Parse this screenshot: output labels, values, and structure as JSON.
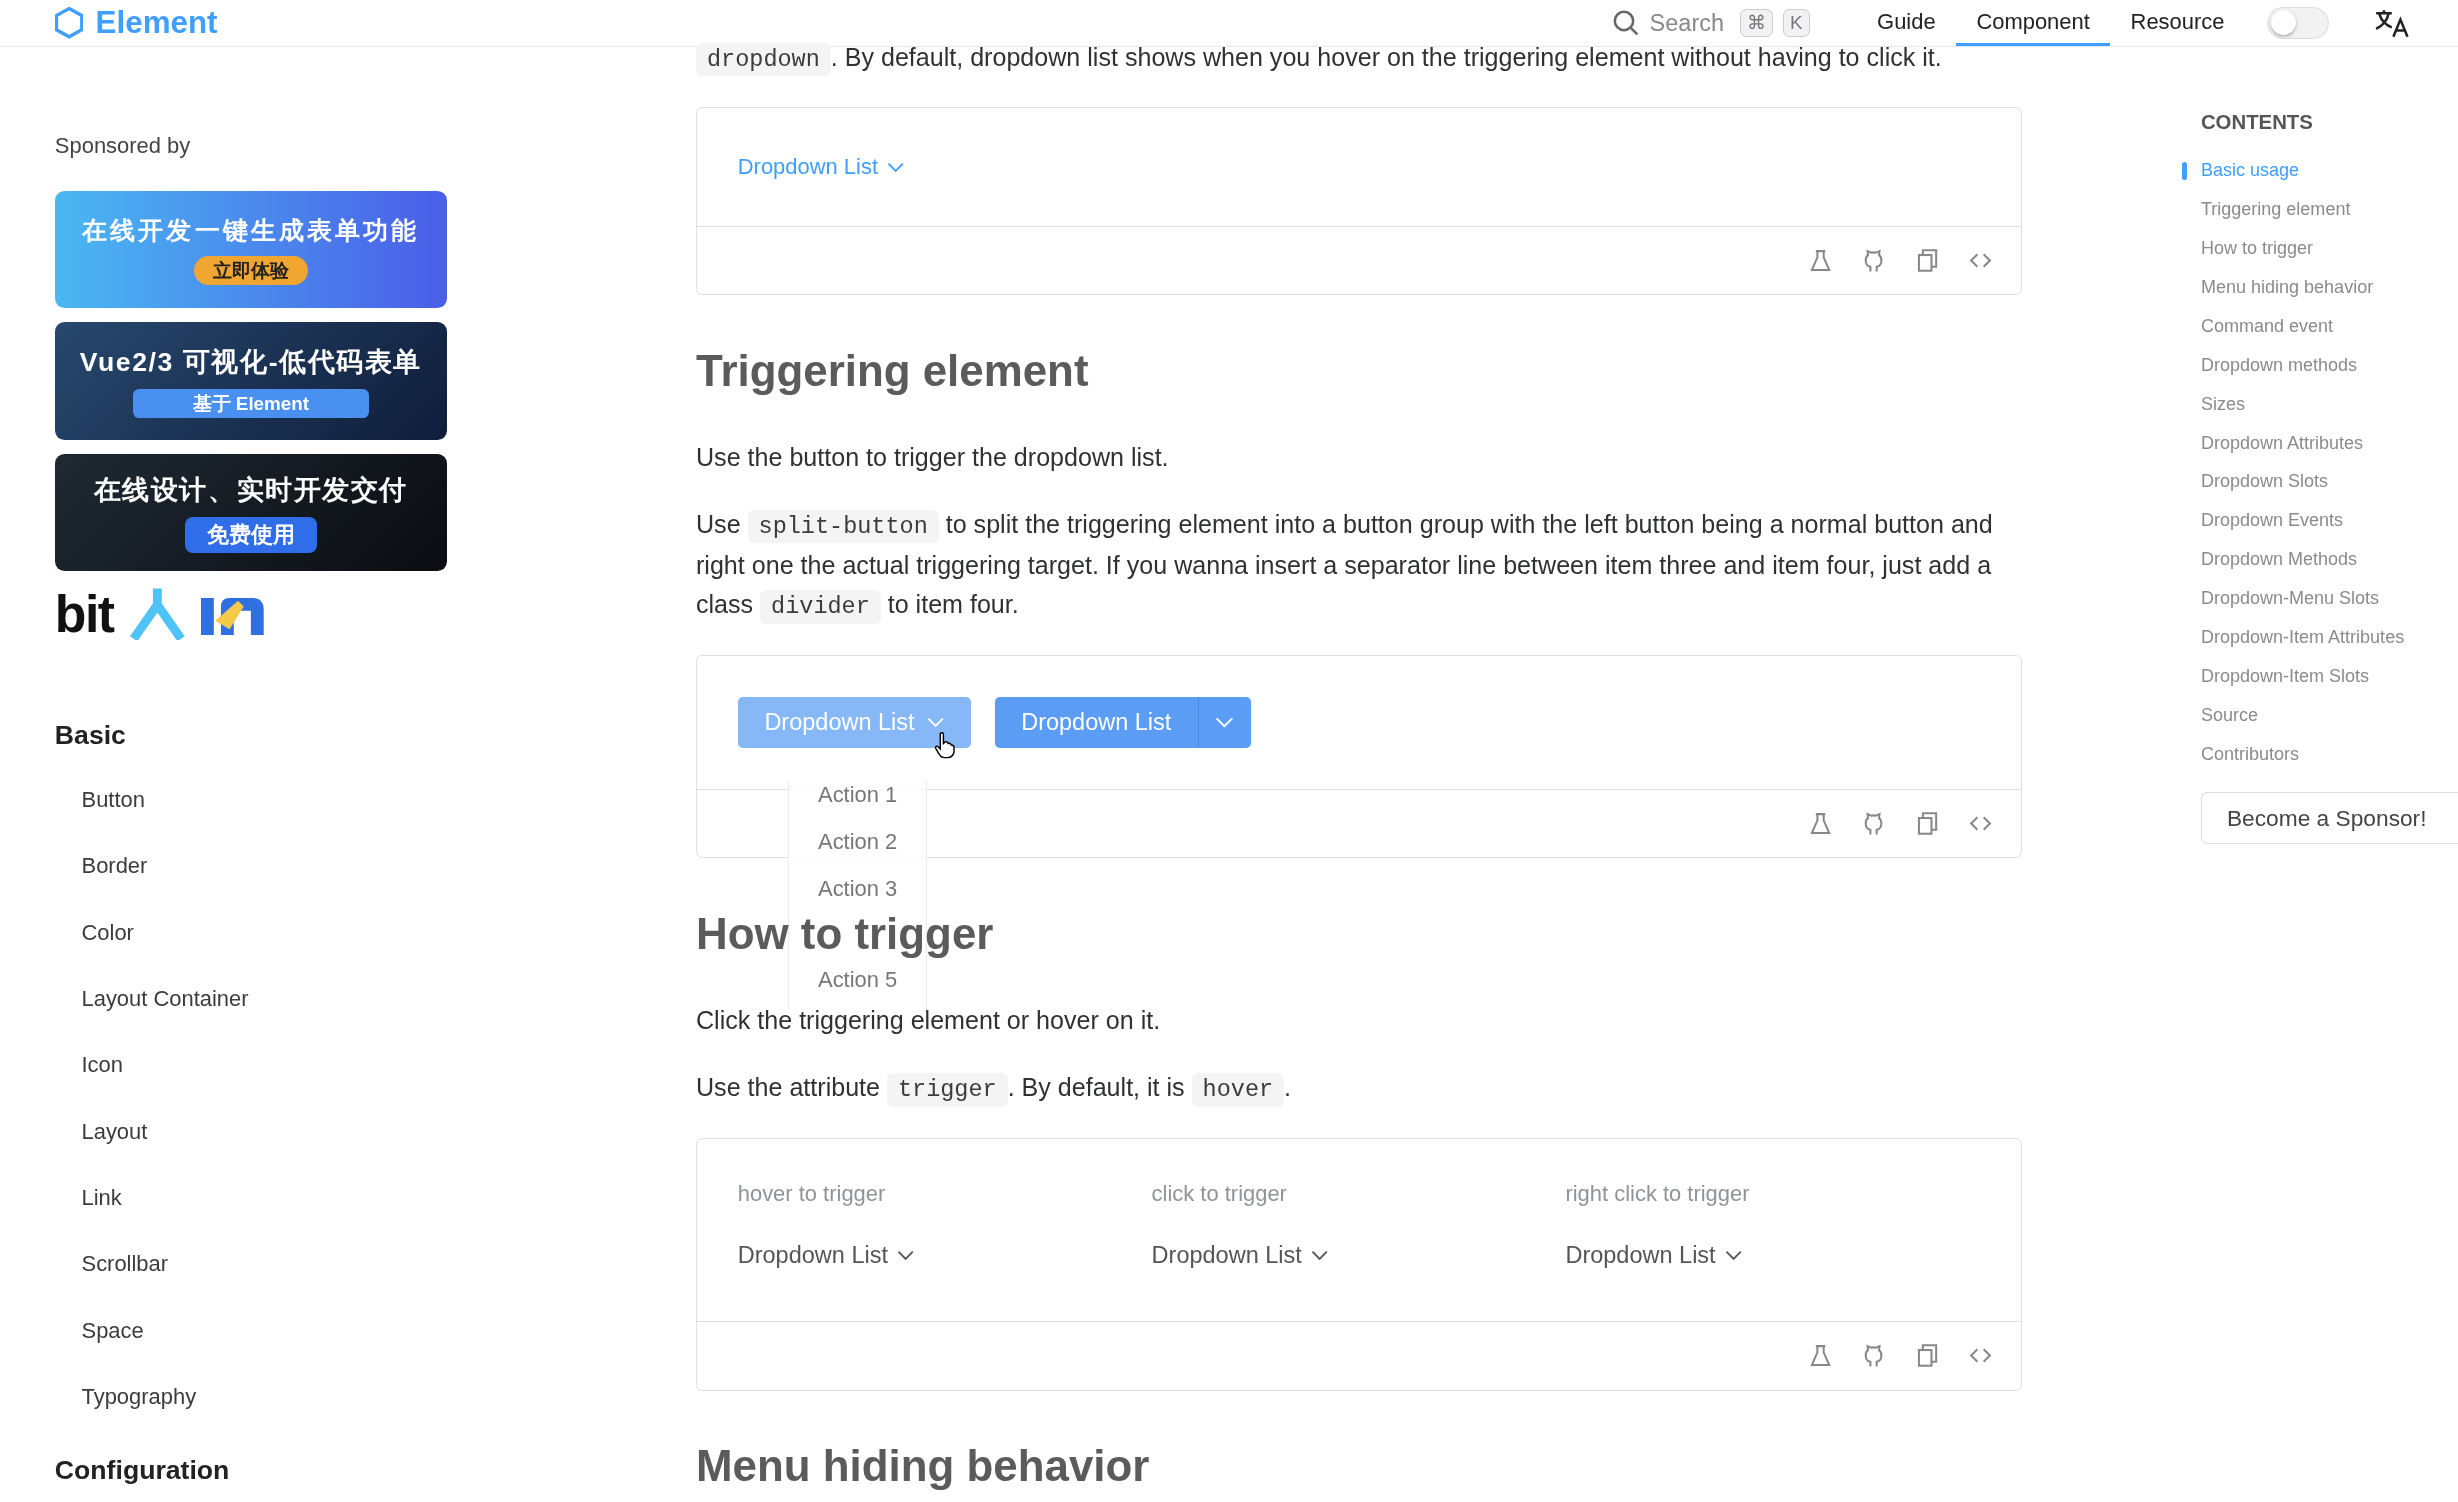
{
  "header": {
    "logo": "Element",
    "search": {
      "placeholder": "Search",
      "keys": [
        "⌘",
        "K"
      ]
    },
    "nav": [
      {
        "label": "Guide",
        "selected": false
      },
      {
        "label": "Component",
        "selected": true
      },
      {
        "label": "Resource",
        "selected": false
      }
    ],
    "dark_mode": false
  },
  "sidebar": {
    "sponsor_heading": "Sponsored by",
    "ads": [
      {
        "kind": "gradient",
        "title": "在线开发一键生成表单功能",
        "badge": "立即体验"
      },
      {
        "kind": "circuit",
        "title": "Vue2/3 可视化-低代码表单",
        "badge": "基于 Element"
      },
      {
        "kind": "dashboard",
        "title": "在线设计、实时开发交付",
        "badge": "免费使用"
      }
    ],
    "sponsor_logos": [
      {
        "kind": "text",
        "text": "bit"
      },
      {
        "kind": "person"
      },
      {
        "kind": "blocks"
      }
    ],
    "groups": [
      {
        "title": "Basic",
        "items": [
          "Button",
          "Border",
          "Color",
          "Layout Container",
          "Icon",
          "Layout",
          "Link",
          "Scrollbar",
          "Space",
          "Typography"
        ]
      },
      {
        "title": "Configuration"
      }
    ]
  },
  "content": [
    {
      "kind": "paragraph",
      "segments": [
        {
          "kind": "code",
          "text": "dropdown"
        },
        {
          "kind": "text",
          "text": ". By default, dropdown list shows when you hover on the triggering element without having to click it."
        }
      ]
    },
    {
      "kind": "demo",
      "demo": {
        "kind": "link",
        "trigger": "Dropdown List"
      }
    },
    {
      "kind": "heading",
      "text": "Triggering element"
    },
    {
      "kind": "paragraph",
      "segments": [
        {
          "kind": "text",
          "text": "Use the button to trigger the dropdown list."
        }
      ]
    },
    {
      "kind": "paragraph",
      "segments": [
        {
          "kind": "text",
          "text": "Use "
        },
        {
          "kind": "code",
          "text": "split-button"
        },
        {
          "kind": "text",
          "text": " to split the triggering element into a button group with the left button being a normal button and right one the actual triggering target. If you wanna insert a separator line between item three and item four, just add a class "
        },
        {
          "kind": "code",
          "text": "divider"
        },
        {
          "kind": "text",
          "text": " to item four."
        }
      ]
    },
    {
      "kind": "demo",
      "demo": {
        "kind": "buttons",
        "buttons": [
          {
            "kind": "dropdown",
            "label": "Dropdown List",
            "hovered": true,
            "menu": [
              "Action 1",
              "Action 2",
              "Action 3",
              "Action 5"
            ]
          },
          {
            "kind": "split",
            "label": "Dropdown List",
            "hovered": false
          }
        ]
      }
    },
    {
      "kind": "heading",
      "text": "How to trigger"
    },
    {
      "kind": "paragraph",
      "segments": [
        {
          "kind": "text",
          "text": "Click the triggering element or hover on it."
        }
      ]
    },
    {
      "kind": "paragraph",
      "segments": [
        {
          "kind": "text",
          "text": "Use the attribute "
        },
        {
          "kind": "code",
          "text": "trigger"
        },
        {
          "kind": "text",
          "text": ". By default, it is "
        },
        {
          "kind": "code",
          "text": "hover"
        },
        {
          "kind": "text",
          "text": "."
        }
      ]
    },
    {
      "kind": "demo",
      "demo": {
        "kind": "triggers",
        "columns": [
          {
            "label": "hover to trigger",
            "trigger": "Dropdown List"
          },
          {
            "label": "click to trigger",
            "trigger": "Dropdown List"
          },
          {
            "label": "right click to trigger",
            "trigger": "Dropdown List"
          }
        ]
      }
    },
    {
      "kind": "heading",
      "text": "Menu hiding behavior"
    }
  ],
  "contents": {
    "heading": "CONTENTS",
    "items": [
      {
        "label": "Basic usage",
        "selected": true
      },
      {
        "label": "Triggering element",
        "selected": false
      },
      {
        "label": "How to trigger",
        "selected": false
      },
      {
        "label": "Menu hiding behavior",
        "selected": false
      },
      {
        "label": "Command event",
        "selected": false
      },
      {
        "label": "Dropdown methods",
        "selected": false
      },
      {
        "label": "Sizes",
        "selected": false
      },
      {
        "label": "Dropdown Attributes",
        "selected": false
      },
      {
        "label": "Dropdown Slots",
        "selected": false
      },
      {
        "label": "Dropdown Events",
        "selected": false
      },
      {
        "label": "Dropdown Methods",
        "selected": false
      },
      {
        "label": "Dropdown-Menu Slots",
        "selected": false
      },
      {
        "label": "Dropdown-Item Attributes",
        "selected": false
      },
      {
        "label": "Dropdown-Item Slots",
        "selected": false
      },
      {
        "label": "Source",
        "selected": false
      },
      {
        "label": "Contributors",
        "selected": false
      }
    ],
    "sponsor_button": "Become a Sponsor!"
  }
}
